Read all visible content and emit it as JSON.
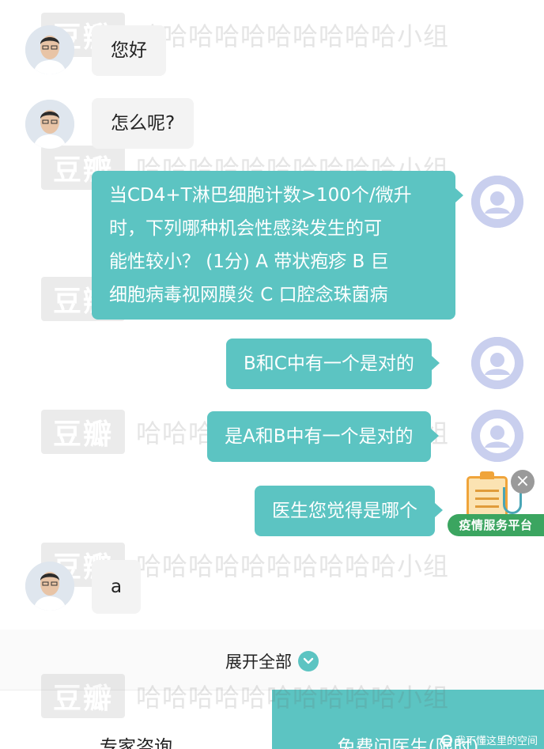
{
  "watermark": {
    "logo": "豆瓣",
    "text": "哈哈哈哈哈哈哈哈哈哈小组"
  },
  "messages": [
    {
      "side": "left",
      "text": "您好"
    },
    {
      "side": "left",
      "text": "怎么呢?"
    },
    {
      "side": "right",
      "lines": [
        "当CD4+T淋巴细胞计数>100个/微升",
        "时，下列哪种机会性感染发生的可",
        "能性较小？ (1分) A 带状疱疹 B 巨",
        "细胞病毒视网膜炎 C 口腔念珠菌病"
      ]
    },
    {
      "side": "right",
      "text": "B和C中有一个是对的"
    },
    {
      "side": "right",
      "text": "是A和B中有一个是对的"
    },
    {
      "side": "right",
      "text": "医生您觉得是哪个"
    },
    {
      "side": "left",
      "text": "a"
    }
  ],
  "floating_widget": {
    "label": "疫情服务平台",
    "close_symbol": "×"
  },
  "expand": {
    "label": "展开全部"
  },
  "bottom_bar": {
    "expert_label": "专家咨询",
    "free_label": "免费问医生(限时)"
  },
  "credit": {
    "text": "我不懂这里的空间"
  },
  "colors": {
    "accent": "#5cc4c2",
    "badge_green": "#3ba560",
    "bubble_left": "#f3f3f3"
  }
}
